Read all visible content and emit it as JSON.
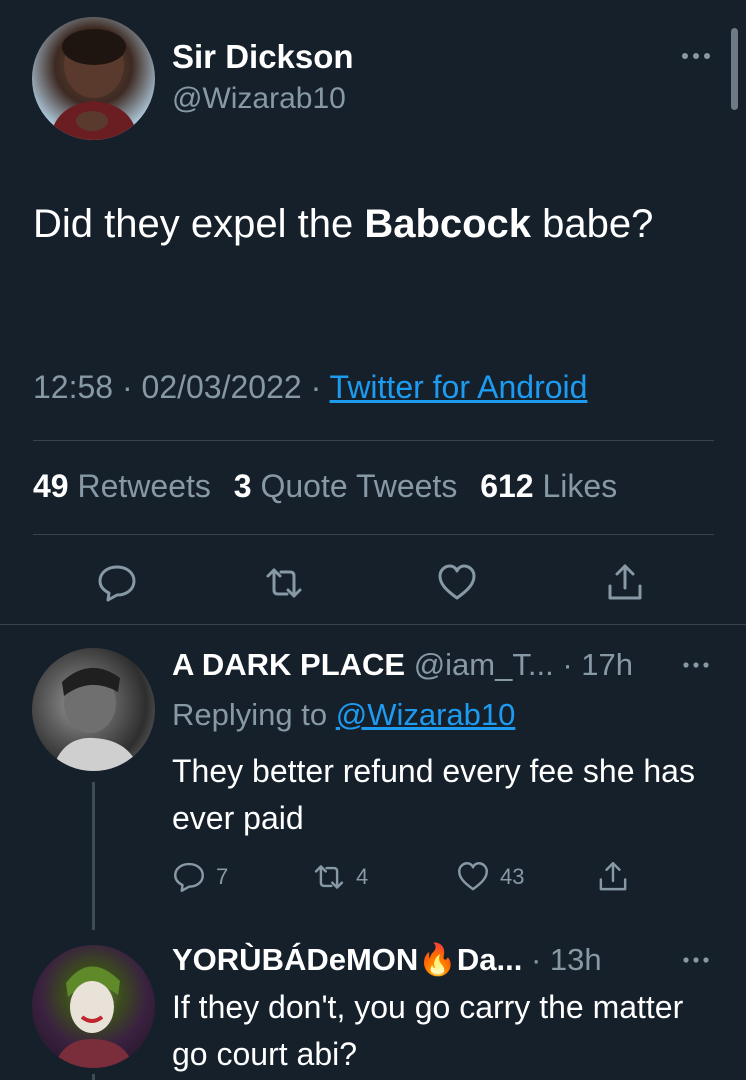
{
  "main_tweet": {
    "author_name": "Sir Dickson",
    "author_handle": "@Wizarab10",
    "text_before": "Did they expel the ",
    "text_bold": "Babcock",
    "text_after": " babe?",
    "time": "12:58",
    "date": "02/03/2022",
    "separator": "·",
    "source": "Twitter for Android",
    "retweets_count": "49",
    "retweets_label": "Retweets",
    "quotes_count": "3",
    "quotes_label": "Quote Tweets",
    "likes_count": "612",
    "likes_label": "Likes",
    "actions": [
      "reply-icon",
      "retweet-icon",
      "like-icon",
      "share-icon"
    ]
  },
  "replies": [
    {
      "name": "A DARK PLACE",
      "handle": "@iam_T...",
      "time": "· 17h",
      "replying_prefix": "Replying to ",
      "replying_to": "@Wizarab10",
      "text": "They better refund every fee she has ever paid",
      "reply_count": "7",
      "retweet_count": "4",
      "like_count": "43"
    },
    {
      "name": "YORÙBÁDeMON",
      "emoji": "🔥",
      "name_suffix": "Da...",
      "time": "· 13h",
      "text": "If they don't, you go carry the matter go court abi?"
    }
  ],
  "colors": {
    "background": "#15202b",
    "accent": "#1d9bf0",
    "secondary_text": "#8899a6",
    "divider": "#38444d"
  }
}
